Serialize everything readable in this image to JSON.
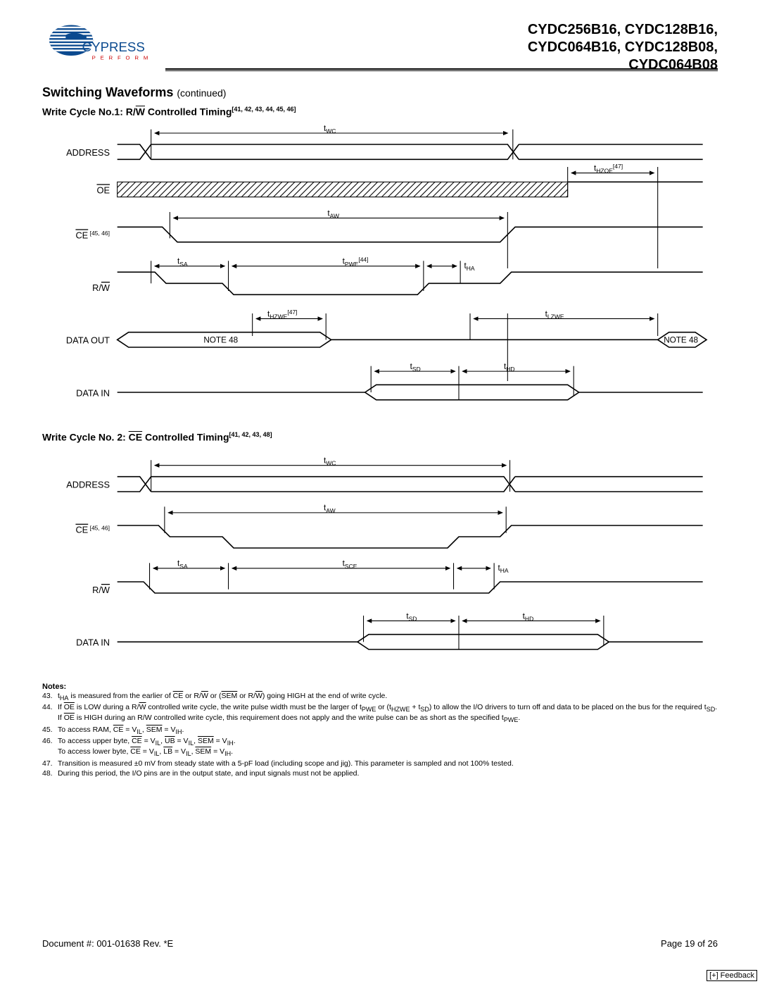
{
  "header": {
    "brand": "CYPRESS",
    "tagline": "P E R F O R M",
    "parts_line1": "CYDC256B16, CYDC128B16,",
    "parts_line2": "CYDC064B16, CYDC128B08,",
    "parts_line3": "CYDC064B08"
  },
  "section": {
    "title": "Switching Waveforms",
    "continued": "(continued)"
  },
  "sub1": {
    "prefix": "Write Cycle No.1: R/",
    "w": "W",
    "suffix": " Controlled Timing",
    "refs": "[41, 42, 43, 44, 45, 46]"
  },
  "sub2": {
    "prefix": "Write Cycle No. 2: ",
    "ce": "CE",
    "suffix": " Controlled Timing",
    "refs": "[41, 42, 43, 48]"
  },
  "diagram1": {
    "signals": {
      "s1": "ADDRESS",
      "s2_oe": "OE",
      "s3_ce": "CE",
      "s3_refs": " [45, 46]",
      "s4": "R/W",
      "s5": "DATA OUT",
      "s6": "DATA IN"
    },
    "labels": {
      "twc": "t",
      "twc_sub": "WC",
      "thzoe": "t",
      "thzoe_sub": "HZOE",
      "thzoe_ref": "[47]",
      "taw": "t",
      "taw_sub": "AW",
      "tsa": "t",
      "tsa_sub": "SA",
      "tpwe": "t",
      "tpwe_sub": "PWE",
      "tpwe_ref": "[44]",
      "tha": "t",
      "tha_sub": "HA",
      "thzwe": "t",
      "thzwe_sub": "HZWE",
      "thzwe_ref": "[47]",
      "tlzwe": "t",
      "tlzwe_sub": "LZWE",
      "note48a": "NOTE 48",
      "note48b": "NOTE 48",
      "tsd": "t",
      "tsd_sub": "SD",
      "thd": "t",
      "thd_sub": "HD"
    }
  },
  "diagram2": {
    "signals": {
      "s1": "ADDRESS",
      "s2_ce": "CE",
      "s2_refs": " [45, 46]",
      "s3": "R/W",
      "s4": "DATA IN"
    },
    "labels": {
      "twc": "t",
      "twc_sub": "WC",
      "taw": "t",
      "taw_sub": "AW",
      "tsa": "t",
      "tsa_sub": "SA",
      "tsce": "t",
      "tsce_sub": "SCE",
      "tha": "t",
      "tha_sub": "HA",
      "tsd": "t",
      "tsd_sub": "SD",
      "thd": "t",
      "thd_sub": "HD"
    }
  },
  "notes_hdr": "Notes:",
  "notes": [
    {
      "n": "43.",
      "t": "t<sub>HA</sub> is measured from the earlier of <span class='over'>CE</span> or R/<span class='over'>W</span> or (<span class='over'>SEM</span> or R/<span class='over'>W</span>) going HIGH at the end of write cycle."
    },
    {
      "n": "44.",
      "t": "If <span class='over'>OE</span> is LOW during a R/<span class='over'>W</span> controlled write cycle, the write pulse width must be the larger of t<sub>PWE</sub> or (t<sub>HZWE</sub> + t<sub>SD</sub>) to allow the I/O drivers to turn off and data to be placed on the bus for the required t<sub>SD</sub>. If <span class='over'>OE</span> is HIGH during an R/W controlled write cycle, this requirement does not apply and the write pulse can be as short as the specified t<sub>PWE</sub>."
    },
    {
      "n": "45.",
      "t": "To access RAM, <span class='over'>CE</span> = V<sub>IL</sub>, <span class='over'>SEM</span> = V<sub>IH</sub>."
    },
    {
      "n": "46.",
      "t": "To access upper byte, <span class='over'>CE</span> = V<sub>IL</sub>, <span class='over'>UB</span> = V<sub>IL</sub>, <span class='over'>SEM</span> = V<sub>IH</sub>.<br>To access lower byte, <span class='over'>CE</span> = V<sub>IL</sub>, <span class='over'>LB</span> = V<sub>IL</sub>, <span class='over'>SEM</span> = V<sub>IH</sub>."
    },
    {
      "n": "47.",
      "t": "Transition is measured ±0 mV from steady state with a 5-pF load (including scope and jig). This parameter is sampled and not 100% tested."
    },
    {
      "n": "48.",
      "t": "During this period, the I/O pins are in the output state, and input signals must not be applied."
    }
  ],
  "footer": {
    "doc": "Document #: 001-01638 Rev. *E",
    "page": "Page 19 of 26"
  },
  "feedback": "[+] Feedback"
}
